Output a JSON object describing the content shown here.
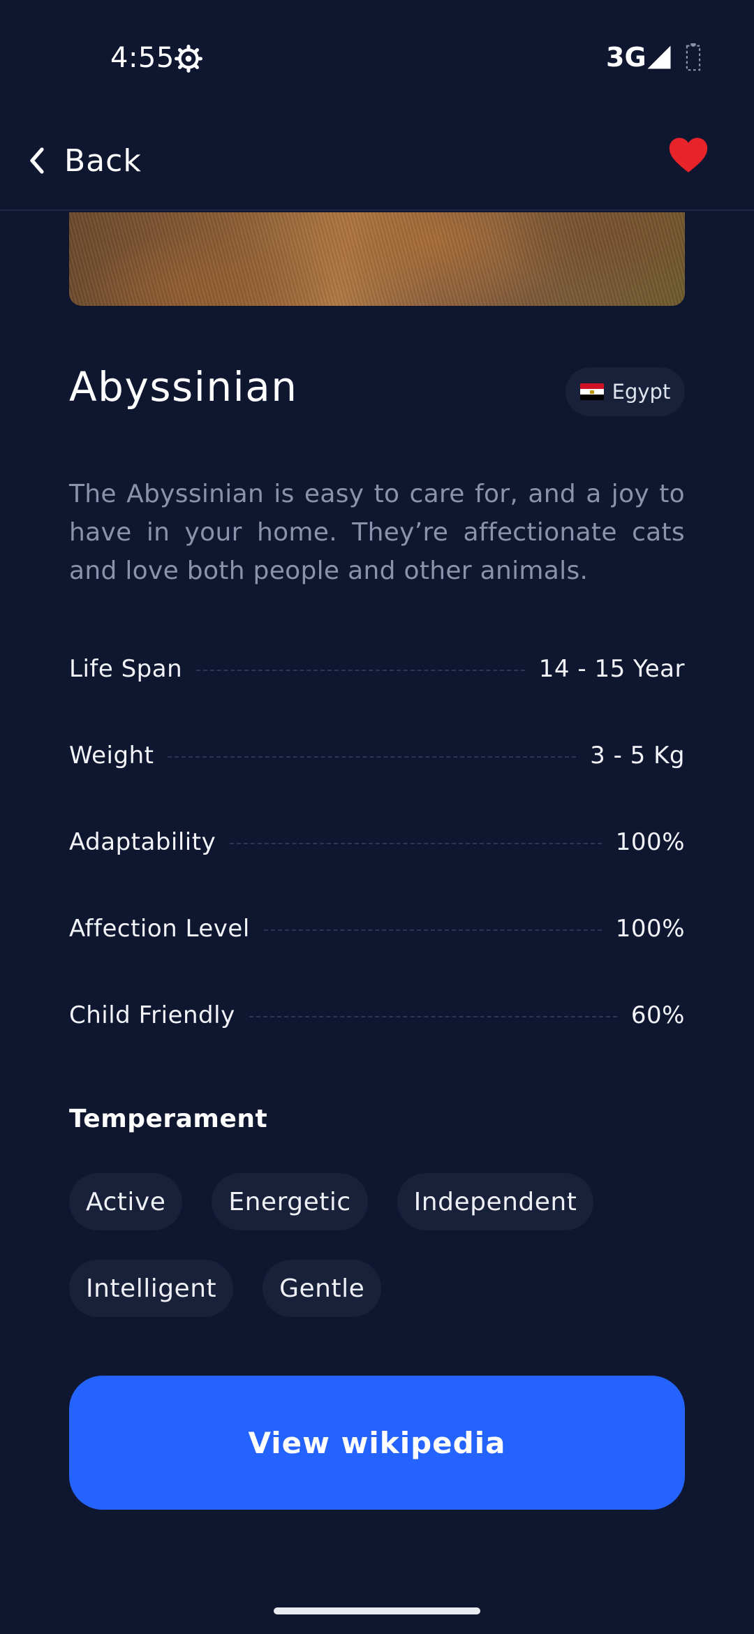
{
  "status_bar": {
    "time": "4:55",
    "network": "3G",
    "icons": [
      "settings-gear-icon",
      "cell-signal-icon",
      "battery-icon"
    ]
  },
  "header": {
    "back_label": "Back",
    "favorite": true,
    "favorite_color": "#e8232a"
  },
  "breed": {
    "name": "Abyssinian",
    "origin": "Egypt",
    "origin_flag": "egypt-flag-icon",
    "description": "The Abyssinian is easy to care for, and a joy to have in your home. They’re affectionate cats and love both people and other animals."
  },
  "stats": [
    {
      "label": "Life Span",
      "value": "14 - 15 Year"
    },
    {
      "label": "Weight",
      "value": "3 - 5 Kg"
    },
    {
      "label": "Adaptability",
      "value": "100%"
    },
    {
      "label": "Affection Level",
      "value": "100%"
    },
    {
      "label": "Child Friendly",
      "value": "60%"
    }
  ],
  "temperament": {
    "title": "Temperament",
    "traits": [
      "Active",
      "Energetic",
      "Independent",
      "Intelligent",
      "Gentle"
    ]
  },
  "action": {
    "label": "View wikipedia",
    "color": "#2563ff"
  },
  "theme": {
    "background": "#0e1630",
    "chip_background": "#18203a"
  }
}
